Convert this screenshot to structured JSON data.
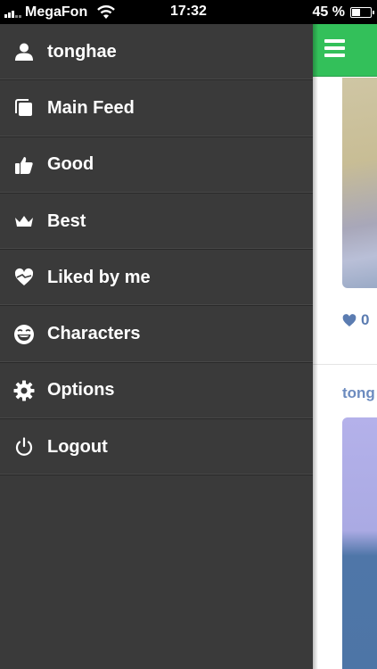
{
  "status_bar": {
    "carrier": "MegaFon",
    "time": "17:32",
    "battery_text": "45 %",
    "battery_level": 0.45
  },
  "drawer": {
    "items": [
      {
        "label": "tonghae",
        "icon": "user-icon"
      },
      {
        "label": "Main Feed",
        "icon": "feed-icon"
      },
      {
        "label": "Good",
        "icon": "thumbs-up-icon"
      },
      {
        "label": "Best",
        "icon": "crown-icon"
      },
      {
        "label": "Liked by me",
        "icon": "heart-icon"
      },
      {
        "label": "Characters",
        "icon": "smiley-face-icon"
      },
      {
        "label": "Options",
        "icon": "gear-icon"
      },
      {
        "label": "Logout",
        "icon": "power-icon"
      }
    ]
  },
  "content": {
    "like_count": "0",
    "username": "tong",
    "colors": {
      "header_green": "#33c05a",
      "link_blue": "#6c8bbf"
    }
  }
}
